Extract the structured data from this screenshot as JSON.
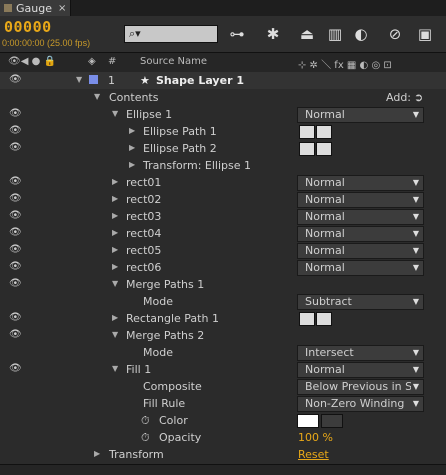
{
  "tab": {
    "label": "Gauge",
    "close": "×"
  },
  "toolbar": {
    "timecode": "00000",
    "fps": "0:00:00:00 (25.00 fps)",
    "search_glyph": "⌕▾"
  },
  "columns": {
    "source_name": "Source Name",
    "num": "#",
    "switches": "⊹ ✲ ＼ fx ▦ ◐ ◎ ⊡"
  },
  "layer": {
    "index": "1",
    "star": "★",
    "name": "Shape Layer 1"
  },
  "rows": [
    {
      "label": "Contents",
      "add": "Add:"
    },
    {
      "label": "Ellipse 1",
      "mode": "Normal"
    },
    {
      "label": "Ellipse Path 1"
    },
    {
      "label": "Ellipse Path 2"
    },
    {
      "label": "Transform: Ellipse 1"
    },
    {
      "label": "rect01",
      "mode": "Normal"
    },
    {
      "label": "rect02",
      "mode": "Normal"
    },
    {
      "label": "rect03",
      "mode": "Normal"
    },
    {
      "label": "rect04",
      "mode": "Normal"
    },
    {
      "label": "rect05",
      "mode": "Normal"
    },
    {
      "label": "rect06",
      "mode": "Normal"
    },
    {
      "label": "Merge Paths 1"
    },
    {
      "label": "Mode",
      "mode": "Subtract"
    },
    {
      "label": "Rectangle Path 1"
    },
    {
      "label": "Merge Paths 2"
    },
    {
      "label": "Mode",
      "mode": "Intersect"
    },
    {
      "label": "Fill 1",
      "mode": "Normal"
    },
    {
      "label": "Composite",
      "mode": "Below Previous in S"
    },
    {
      "label": "Fill Rule",
      "mode": "Non-Zero Winding"
    },
    {
      "label": "Color"
    },
    {
      "label": "Opacity",
      "value": "100 %"
    },
    {
      "label": "Transform",
      "value": "Reset"
    }
  ]
}
